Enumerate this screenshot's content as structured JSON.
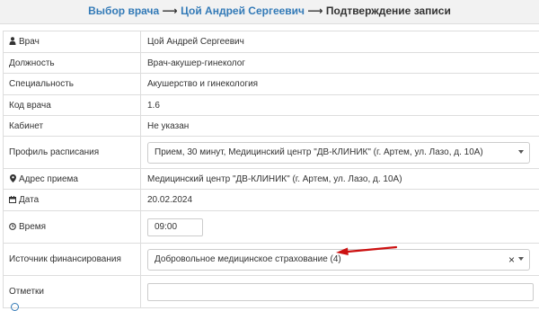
{
  "breadcrumb": {
    "step1": "Выбор врача",
    "sep1": "⟶",
    "step2": "Цой Андрей Сергеевич",
    "sep2": "⟶",
    "current": "Подтверждение записи"
  },
  "form": {
    "doctor_label": "Врач",
    "doctor_value": "Цой Андрей Сергеевич",
    "position_label": "Должность",
    "position_value": "Врач-акушер-гинеколог",
    "specialty_label": "Специальность",
    "specialty_value": "Акушерство и гинекология",
    "doctor_code_label": "Код врача",
    "doctor_code_value": "1.6",
    "cabinet_label": "Кабинет",
    "cabinet_value": "Не указан",
    "schedule_profile_label": "Профиль расписания",
    "schedule_profile_value": "Прием, 30 минут, Медицинский центр \"ДВ-КЛИНИК\" (г. Артем, ул. Лазо, д. 10А)",
    "address_label": "Адрес приема",
    "address_value": "Медицинский центр \"ДВ-КЛИНИК\" (г. Артем, ул. Лазо, д. 10А)",
    "date_label": "Дата",
    "date_value": "20.02.2024",
    "time_label": "Время",
    "time_value": "09:00",
    "funding_label": "Источник финансирования",
    "funding_value": "Добровольное медицинское страхование (4)",
    "notes_label": "Отметки",
    "notes_value": ""
  },
  "icons": {
    "doctor": "user-md-icon",
    "address": "map-marker-icon",
    "date": "calendar-icon",
    "time": "clock-icon"
  },
  "colors": {
    "link": "#337ab7",
    "annotation_arrow": "#cc1111"
  }
}
